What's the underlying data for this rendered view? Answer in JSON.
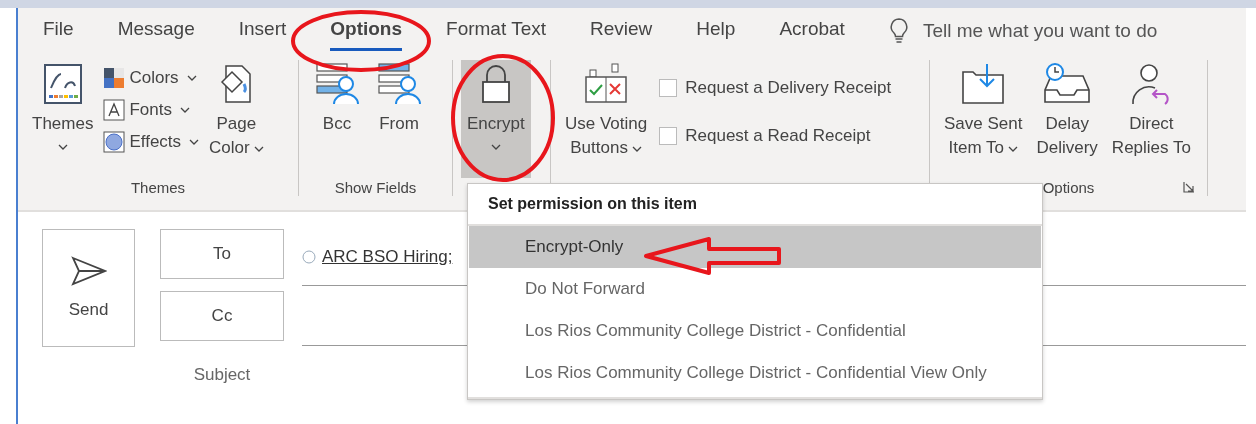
{
  "tabs": [
    {
      "label": "File",
      "selected": false
    },
    {
      "label": "Message",
      "selected": false
    },
    {
      "label": "Insert",
      "selected": false
    },
    {
      "label": "Options",
      "selected": true
    },
    {
      "label": "Format Text",
      "selected": false
    },
    {
      "label": "Review",
      "selected": false
    },
    {
      "label": "Help",
      "selected": false
    },
    {
      "label": "Acrobat",
      "selected": false
    }
  ],
  "tell_me": {
    "placeholder": "Tell me what you want to do"
  },
  "groups": [
    {
      "label": "Themes",
      "items": [
        {
          "kind": "tall",
          "label": "Themes",
          "dropdown": true,
          "pressed": false
        },
        {
          "kind": "stack",
          "items": [
            {
              "label": "Colors",
              "dropdown": true
            },
            {
              "label": "Fonts",
              "dropdown": true
            },
            {
              "label": "Effects",
              "dropdown": true
            }
          ]
        },
        {
          "kind": "large",
          "label": "Page\nColor",
          "dropdown": true,
          "pressed": false
        }
      ]
    },
    {
      "label": "Show Fields",
      "items": [
        {
          "kind": "large",
          "label": "Bcc",
          "pressed": false
        },
        {
          "kind": "large",
          "label": "From",
          "pressed": false
        }
      ]
    },
    {
      "items": [
        {
          "kind": "tall",
          "label": "Encrypt",
          "dropdown": true,
          "pressed": true
        }
      ]
    },
    {
      "items": [
        {
          "kind": "large",
          "label": "Use Voting\nButtons",
          "dropdown": true,
          "pressed": false
        },
        {
          "kind": "checks",
          "items": [
            {
              "label": "Request a Delivery Receipt",
              "checked": false
            },
            {
              "label": "Request a Read Receipt",
              "checked": false
            }
          ]
        }
      ]
    },
    {
      "label": "Options",
      "launcher": true,
      "items": [
        {
          "kind": "large",
          "label": "Save Sent\nItem To",
          "dropdown": true,
          "pressed": false
        },
        {
          "kind": "large",
          "label": "Delay\nDelivery",
          "pressed": false
        },
        {
          "kind": "large",
          "label": "Direct\nReplies To",
          "pressed": false
        }
      ]
    }
  ],
  "compose": {
    "send": "Send",
    "to": "To",
    "cc": "Cc",
    "recipient": "ARC BSO Hiring;",
    "subject": "Subject"
  },
  "menu": {
    "header": "Set permission on this item",
    "items": [
      {
        "label": "Encrypt-Only",
        "selected": true
      },
      {
        "label": "Do Not Forward",
        "selected": false
      },
      {
        "label": "Los Rios Community College District - Confidential",
        "selected": false
      },
      {
        "label": "Los Rios Community College District - Confidential View Only",
        "selected": false
      }
    ]
  }
}
